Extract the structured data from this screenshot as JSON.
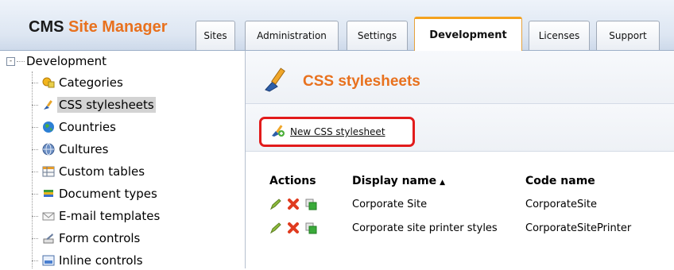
{
  "app": {
    "logo_bold": "CMS",
    "logo_rest": " Site Manager"
  },
  "tabs": [
    {
      "label": "Sites"
    },
    {
      "label": "Administration"
    },
    {
      "label": "Settings"
    },
    {
      "label": "Development",
      "active": true
    },
    {
      "label": "Licenses"
    },
    {
      "label": "Support"
    }
  ],
  "sidebar": {
    "root": {
      "label": "Development",
      "toggle": "-"
    },
    "items": [
      {
        "label": "Categories",
        "icon": "categories-icon"
      },
      {
        "label": "CSS stylesheets",
        "icon": "brush-icon",
        "selected": true
      },
      {
        "label": "Countries",
        "icon": "globe-icon"
      },
      {
        "label": "Cultures",
        "icon": "culture-globe-icon"
      },
      {
        "label": "Custom tables",
        "icon": "table-icon"
      },
      {
        "label": "Document types",
        "icon": "document-types-icon"
      },
      {
        "label": "E-mail templates",
        "icon": "email-icon"
      },
      {
        "label": "Form controls",
        "icon": "form-control-icon"
      },
      {
        "label": "Inline controls",
        "icon": "inline-control-icon"
      }
    ]
  },
  "main": {
    "title": "CSS stylesheets",
    "new_button": "New CSS stylesheet",
    "grid": {
      "headers": {
        "actions": "Actions",
        "display_name": "Display name",
        "sort_glyph": "▲",
        "code_name": "Code name"
      },
      "rows": [
        {
          "display_name": "Corporate Site",
          "code_name": "CorporateSite"
        },
        {
          "display_name": "Corporate site printer styles",
          "code_name": "CorporateSitePrinter"
        }
      ]
    }
  },
  "colors": {
    "accent": "#e8711e",
    "highlight_border": "#e21b1b",
    "active_tab": "#f4a21f"
  }
}
